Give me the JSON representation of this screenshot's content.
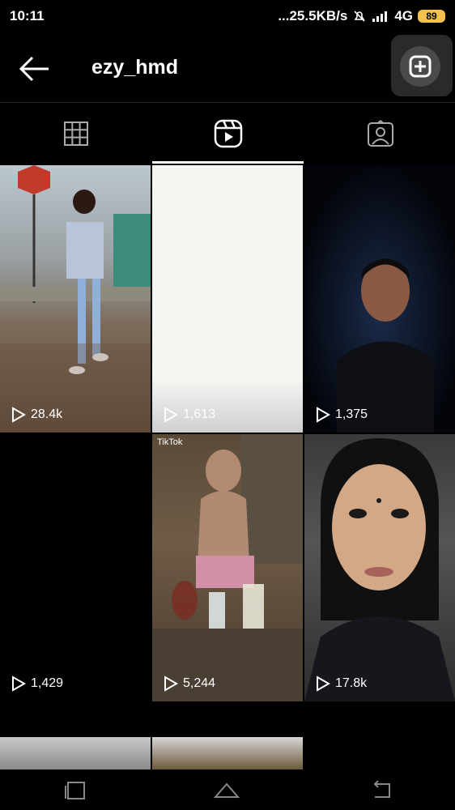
{
  "status": {
    "time": "10:11",
    "speed": "...25.5KB/s",
    "network": "4G",
    "battery": "89"
  },
  "header": {
    "username": "ezy_hmd"
  },
  "tabs": [
    "grid",
    "reels",
    "tagged"
  ],
  "reels": [
    {
      "plays": "28.4k"
    },
    {
      "plays": "1,613"
    },
    {
      "plays": "1,375"
    },
    {
      "plays": "1,429"
    },
    {
      "plays": "5,244",
      "tag": "TikTok"
    },
    {
      "plays": "17.8k"
    }
  ],
  "colors": {
    "background": "#000000",
    "battery": "#f2c14e"
  }
}
